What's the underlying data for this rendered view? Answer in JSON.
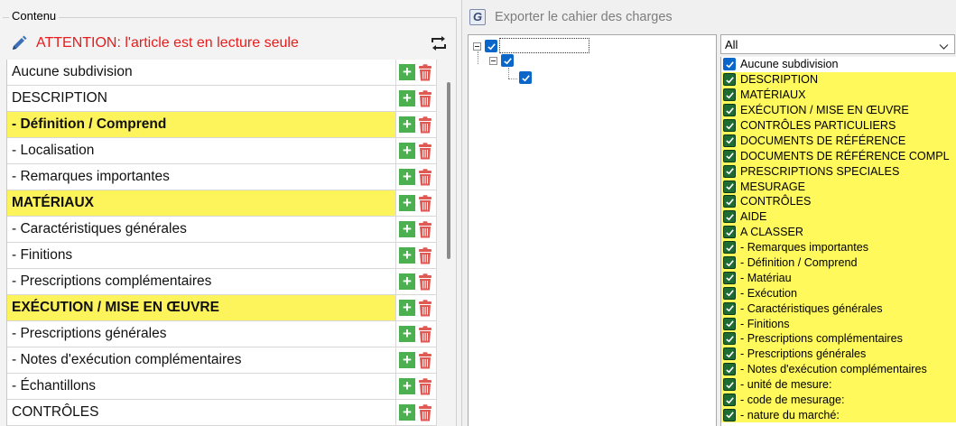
{
  "left": {
    "group_title": "Contenu",
    "warning": "ATTENTION: l'article est en lecture seule",
    "icons": {
      "edit": "pencil-icon",
      "swap": "swap-icon",
      "add": "plus-icon",
      "delete": "trash-icon"
    },
    "rows": [
      {
        "label": "Aucune subdivision",
        "highlight": false
      },
      {
        "label": "DESCRIPTION",
        "highlight": false
      },
      {
        "label": "- Définition / Comprend",
        "highlight": true
      },
      {
        "label": "- Localisation",
        "highlight": false
      },
      {
        "label": "- Remarques importantes",
        "highlight": false
      },
      {
        "label": "MATÉRIAUX",
        "highlight": true
      },
      {
        "label": "- Caractéristiques générales",
        "highlight": false
      },
      {
        "label": "- Finitions",
        "highlight": false
      },
      {
        "label": "- Prescriptions complémentaires",
        "highlight": false
      },
      {
        "label": "EXÉCUTION / MISE EN ŒUVRE",
        "highlight": true
      },
      {
        "label": "- Prescriptions générales",
        "highlight": false
      },
      {
        "label": "- Notes d'exécution complémentaires",
        "highlight": false
      },
      {
        "label": "- Échantillons",
        "highlight": false
      },
      {
        "label": "CONTRÔLES",
        "highlight": false
      }
    ]
  },
  "right": {
    "export_label": "Exporter le cahier des charges",
    "filter_value": "All",
    "items": [
      {
        "label": "Aucune subdivision",
        "style": "blue",
        "highlight": false
      },
      {
        "label": "DESCRIPTION",
        "style": "green",
        "highlight": true
      },
      {
        "label": "MATÉRIAUX",
        "style": "green",
        "highlight": true
      },
      {
        "label": "EXÉCUTION / MISE EN ŒUVRE",
        "style": "green",
        "highlight": true
      },
      {
        "label": "CONTRÔLES PARTICULIERS",
        "style": "green",
        "highlight": true
      },
      {
        "label": "DOCUMENTS DE RÉFÉRENCE",
        "style": "green",
        "highlight": true
      },
      {
        "label": "DOCUMENTS DE RÉFÉRENCE COMPL",
        "style": "green",
        "highlight": true
      },
      {
        "label": "PRESCRIPTIONS SPECIALES",
        "style": "green",
        "highlight": true
      },
      {
        "label": "MESURAGE",
        "style": "green",
        "highlight": true
      },
      {
        "label": "CONTRÔLES",
        "style": "green",
        "highlight": true
      },
      {
        "label": "AIDE",
        "style": "green",
        "highlight": true
      },
      {
        "label": "A CLASSER",
        "style": "green",
        "highlight": true
      },
      {
        "label": "- Remarques importantes",
        "style": "green",
        "highlight": true
      },
      {
        "label": "- Définition / Comprend",
        "style": "green",
        "highlight": true
      },
      {
        "label": "- Matériau",
        "style": "green",
        "highlight": true
      },
      {
        "label": "- Exécution",
        "style": "green",
        "highlight": true
      },
      {
        "label": "- Caractéristiques générales",
        "style": "green",
        "highlight": true
      },
      {
        "label": "- Finitions",
        "style": "green",
        "highlight": true
      },
      {
        "label": "- Prescriptions complémentaires",
        "style": "green",
        "highlight": true
      },
      {
        "label": "- Prescriptions générales",
        "style": "green",
        "highlight": true
      },
      {
        "label": "- Notes d'exécution complémentaires",
        "style": "green",
        "highlight": true
      },
      {
        "label": "- unité de mesure:",
        "style": "green",
        "highlight": true
      },
      {
        "label": "- code de mesurage:",
        "style": "green",
        "highlight": true
      },
      {
        "label": "- nature du marché:",
        "style": "green",
        "highlight": true
      }
    ]
  },
  "colors": {
    "warning": "#e81c1c",
    "highlight": "#fdf35a",
    "add": "#4caf50",
    "delete": "#e05a55",
    "checkbox_blue": "#0a67c9",
    "checkbox_green": "#1f6b34"
  }
}
